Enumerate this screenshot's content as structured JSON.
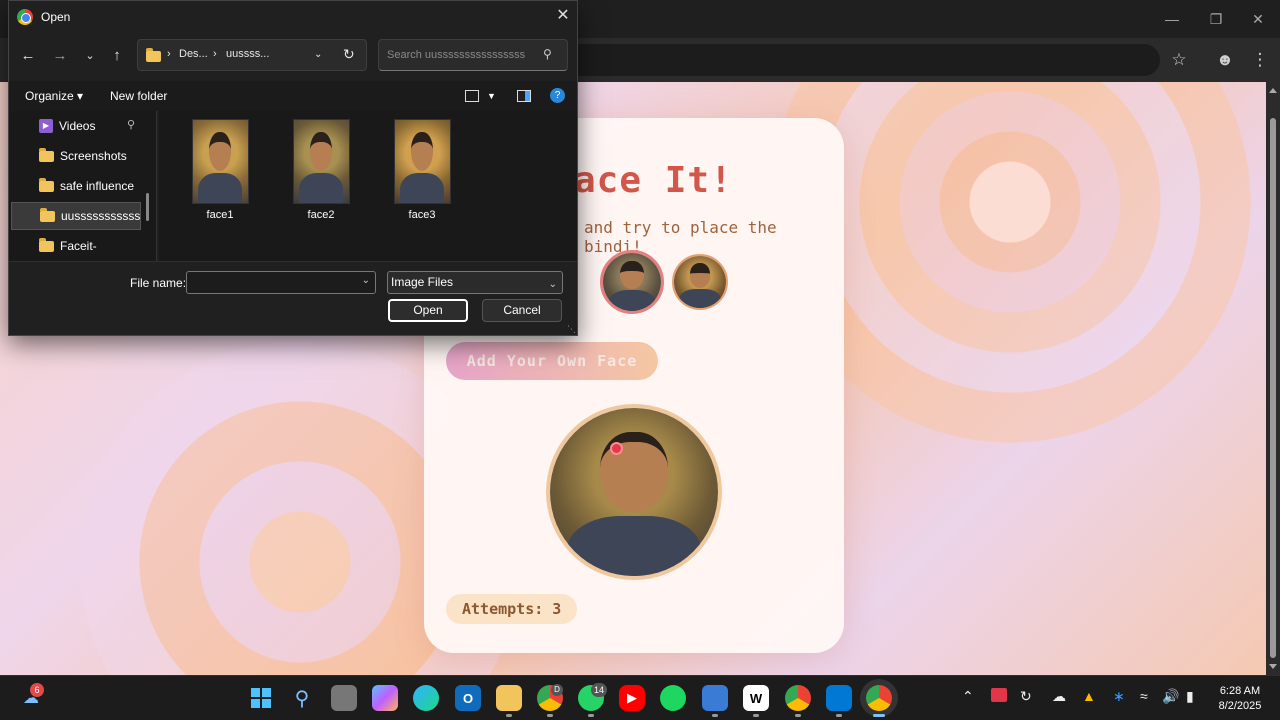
{
  "dialog": {
    "title": "Open",
    "breadcrumb": [
      "Des...",
      "uussss..."
    ],
    "search_placeholder": "Search uussssssssssssssss",
    "organize_label": "Organize",
    "new_folder_label": "New folder",
    "nav_items": [
      {
        "label": "Videos",
        "icon": "videos-icon",
        "pinned": true
      },
      {
        "label": "Screenshots",
        "icon": "folder-icon"
      },
      {
        "label": "safe influence",
        "icon": "folder-icon"
      },
      {
        "label": "uussssssssssssssss",
        "icon": "folder-icon",
        "selected": true
      },
      {
        "label": "Faceit-",
        "icon": "folder-icon"
      }
    ],
    "files": [
      {
        "name": "face1"
      },
      {
        "name": "face2"
      },
      {
        "name": "face3"
      }
    ],
    "file_name_label": "File name:",
    "file_name_value": "",
    "file_type": "Image Files",
    "open_label": "Open",
    "cancel_label": "Cancel"
  },
  "app": {
    "title": "ace It!",
    "subtitle": "and try to place the bindi!",
    "add_face_label": "Add Your Own Face",
    "attempts_label": "Attempts: 3",
    "colors": {
      "title": "#d2564a",
      "bindi": "#e23a4a",
      "selected_ring": "#e77f7f"
    }
  },
  "taskbar": {
    "notification_badge": "6",
    "chrome_badge": "D",
    "whatsapp_badge": "14",
    "time": "6:28 AM",
    "date": "8/2/2025"
  }
}
